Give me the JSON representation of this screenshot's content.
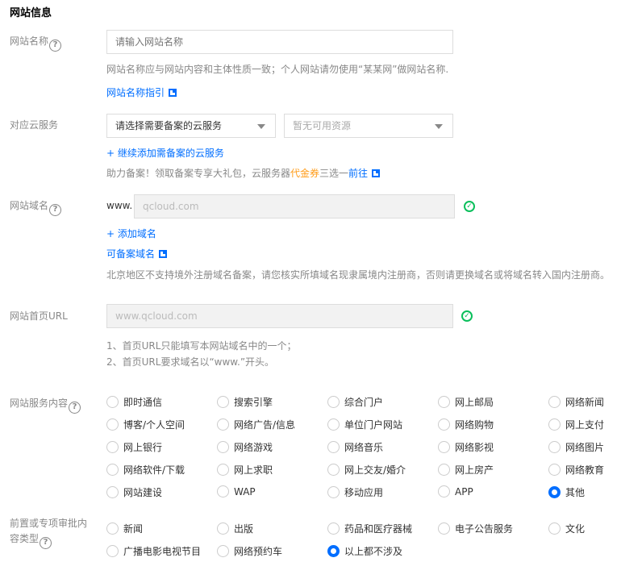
{
  "section_title": "网站信息",
  "site_name": {
    "label": "网站名称",
    "placeholder": "请输入网站名称",
    "hint": "网站名称应与网站内容和主体性质一致；个人网站请勿使用“某某网”做网站名称.",
    "guide_link": "网站名称指引"
  },
  "cloud": {
    "label": "对应云服务",
    "select1": "请选择需要备案的云服务",
    "select2": "暂无可用资源",
    "add_link": "+ 继续添加需备案的云服务",
    "promo_prefix": "助力备案！领取备案专享大礼包，云服务器",
    "promo_highlight": "代金券",
    "promo_mid": "三选一",
    "promo_link": "前往"
  },
  "domain": {
    "label": "网站域名",
    "prefix": "www.",
    "value": "qcloud.com",
    "add_link": "+ 添加域名",
    "available_link": "可备案域名",
    "hint": "北京地区不支持境外注册域名备案，请您核实所填域名现隶属境内注册商，否则请更换域名或将域名转入国内注册商。"
  },
  "homepage": {
    "label": "网站首页URL",
    "value": "www.qcloud.com",
    "hint1": "1、首页URL只能填写本网站域名中的一个；",
    "hint2": "2、首页URL要求域名以“www.”开头。"
  },
  "service": {
    "label": "网站服务内容",
    "options": [
      "即时通信",
      "搜索引擎",
      "综合门户",
      "网上邮局",
      "网络新闻",
      "博客/个人空间",
      "网络广告/信息",
      "单位门户网站",
      "网络购物",
      "网上支付",
      "网上银行",
      "网络游戏",
      "网络音乐",
      "网络影视",
      "网络图片",
      "网络软件/下载",
      "网上求职",
      "网上交友/婚介",
      "网上房产",
      "网络教育",
      "网站建设",
      "WAP",
      "移动应用",
      "APP",
      "其他"
    ],
    "selected": "其他"
  },
  "approval": {
    "label_line1": "前置或专项审批内",
    "label_line2": "容类型",
    "options": [
      "新闻",
      "出版",
      "药品和医疗器械",
      "电子公告服务",
      "文化",
      "广播电影电视节目",
      "网络预约车",
      "以上都不涉及"
    ],
    "selected": "以上都不涉及"
  },
  "colors": {
    "primary": "#006eff",
    "success": "#0abf5b",
    "highlight": "#ff9c19"
  }
}
